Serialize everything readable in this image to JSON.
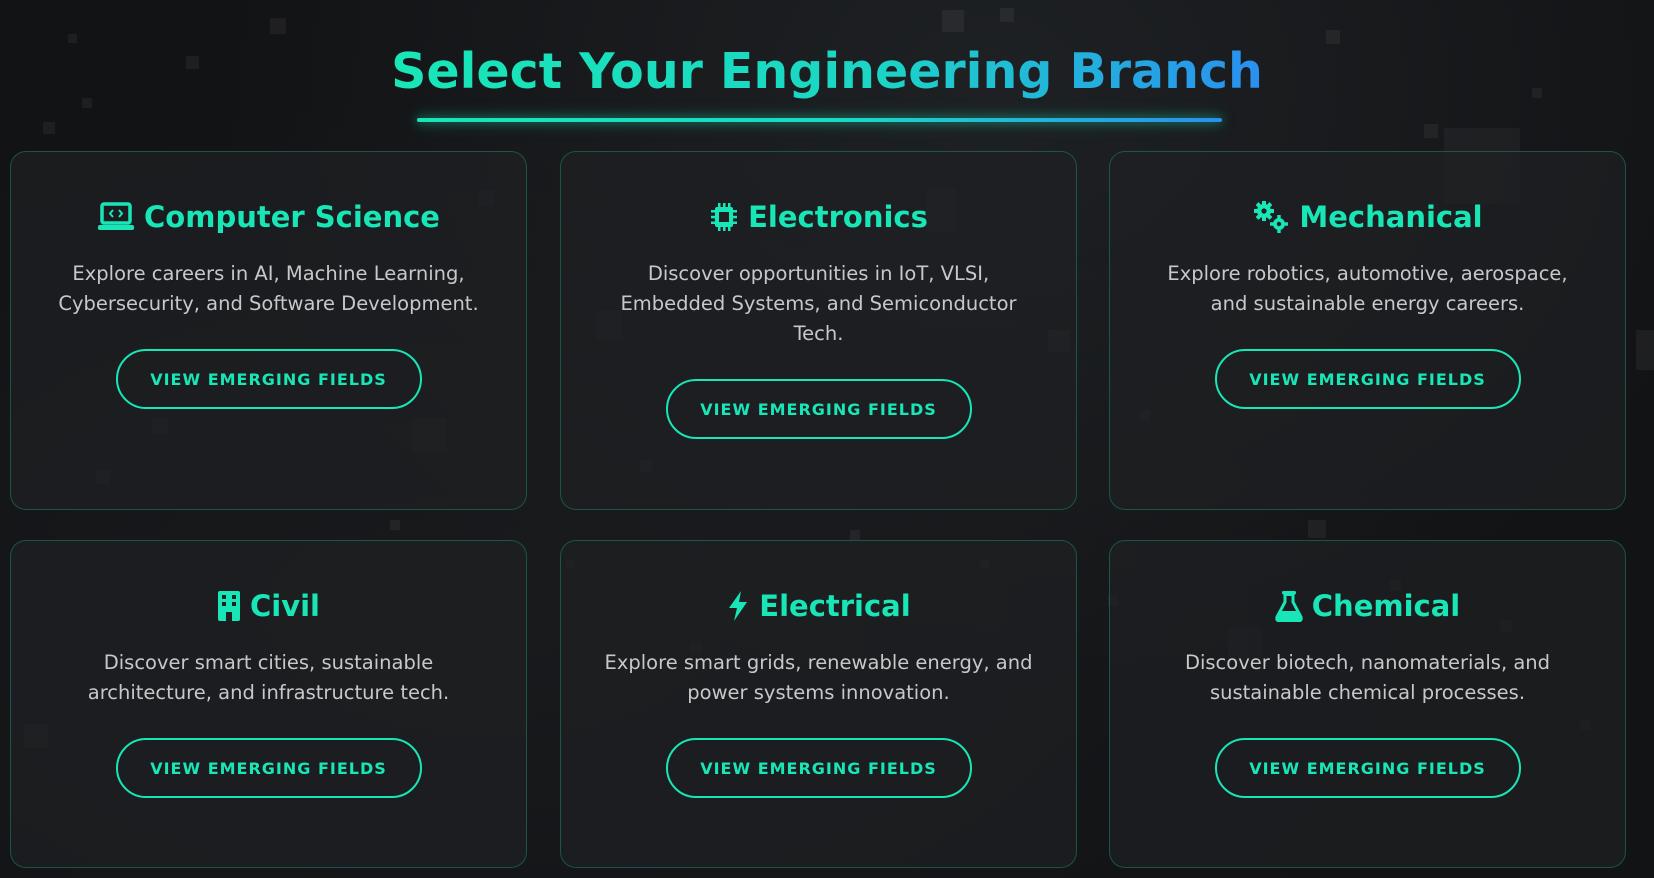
{
  "header": {
    "title": "Select Your Engineering Branch"
  },
  "colors": {
    "accent": "#19e6b7",
    "accent_blue": "#2a8ff0",
    "background": "#121315",
    "card_background": "#1e2022",
    "body_text": "#c6c8ca"
  },
  "branches": [
    {
      "icon": "laptop-code-icon",
      "title": "Computer Science",
      "description": "Explore careers in AI, Machine Learning, Cybersecurity, and Software Development.",
      "button_label": "VIEW EMERGING FIELDS"
    },
    {
      "icon": "microchip-icon",
      "title": "Electronics",
      "description": "Discover opportunities in IoT, VLSI, Embedded Systems, and Semiconductor Tech.",
      "button_label": "VIEW EMERGING FIELDS"
    },
    {
      "icon": "gears-icon",
      "title": "Mechanical",
      "description": "Explore robotics, automotive, aerospace, and sustainable energy careers.",
      "button_label": "VIEW EMERGING FIELDS"
    },
    {
      "icon": "building-icon",
      "title": "Civil",
      "description": "Discover smart cities, sustainable architecture, and infrastructure tech.",
      "button_label": "VIEW EMERGING FIELDS"
    },
    {
      "icon": "bolt-icon",
      "title": "Electrical",
      "description": "Explore smart grids, renewable energy, and power systems innovation.",
      "button_label": "VIEW EMERGING FIELDS"
    },
    {
      "icon": "flask-icon",
      "title": "Chemical",
      "description": "Discover biotech, nanomaterials, and sustainable chemical processes.",
      "button_label": "VIEW EMERGING FIELDS"
    }
  ]
}
